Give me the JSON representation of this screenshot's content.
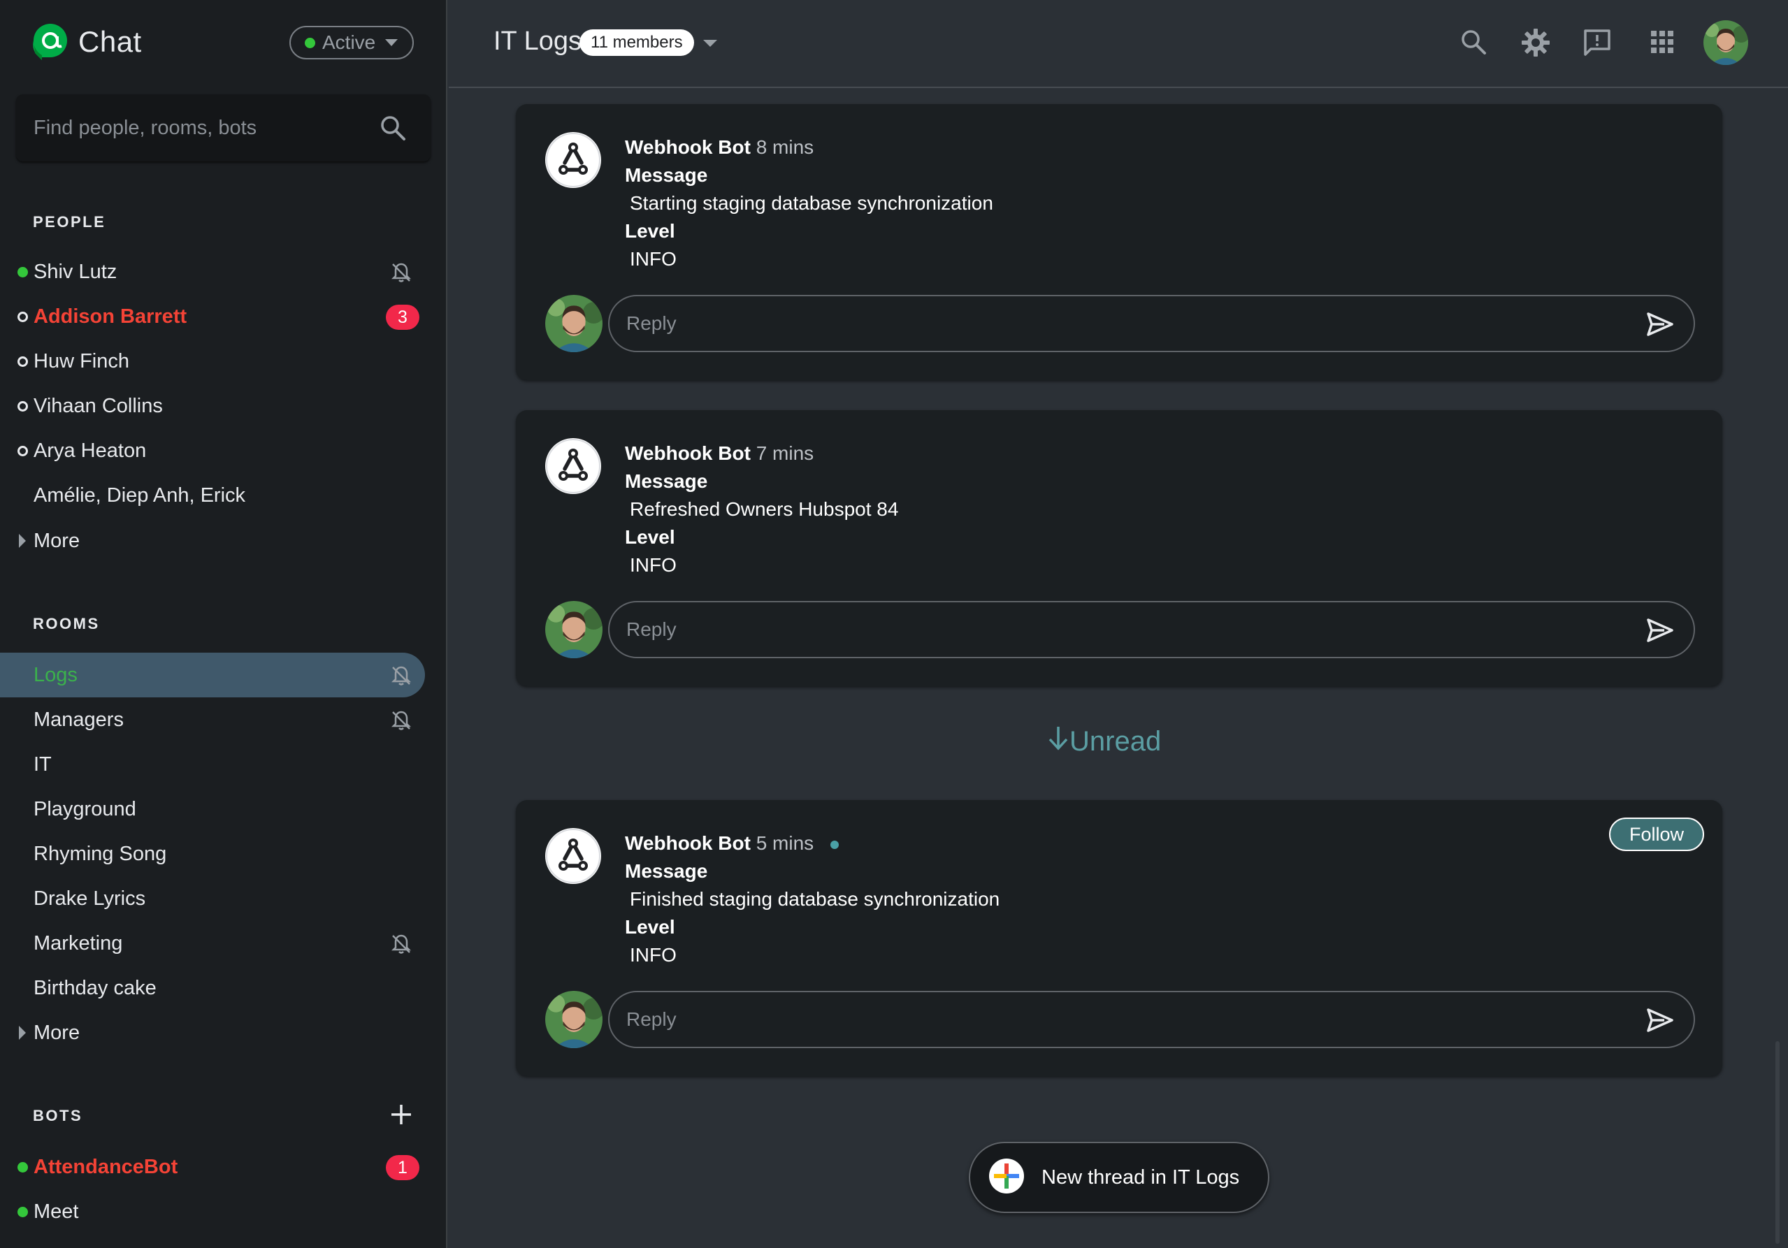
{
  "app": {
    "title": "Chat",
    "status": "Active",
    "accent": "#3bb14c",
    "alert_color": "#f44336"
  },
  "search": {
    "placeholder": "Find people, rooms, bots"
  },
  "people": {
    "heading": "PEOPLE",
    "items": [
      {
        "name": "Shiv Lutz",
        "presence": "online",
        "muted": true
      },
      {
        "name": "Addison Barrett",
        "presence": "offline",
        "badge": "3"
      },
      {
        "name": "Huw Finch",
        "presence": "offline"
      },
      {
        "name": "Vihaan Collins",
        "presence": "offline"
      },
      {
        "name": "Arya Heaton",
        "presence": "offline"
      },
      {
        "name": "Amélie, Diep Anh, Erick",
        "presence": "none"
      }
    ],
    "more": "More"
  },
  "rooms": {
    "heading": "ROOMS",
    "items": [
      {
        "name": "Logs",
        "selected": true,
        "muted": true
      },
      {
        "name": "Managers",
        "muted": true
      },
      {
        "name": "IT"
      },
      {
        "name": "Playground"
      },
      {
        "name": "Rhyming Song"
      },
      {
        "name": "Drake Lyrics"
      },
      {
        "name": "Marketing",
        "muted": true
      },
      {
        "name": "Birthday cake"
      }
    ],
    "more": "More"
  },
  "bots": {
    "heading": "BOTS",
    "items": [
      {
        "name": "AttendanceBot",
        "presence": "online",
        "badge": "1"
      },
      {
        "name": "Meet",
        "presence": "online"
      }
    ]
  },
  "header": {
    "room_title": "IT Logs",
    "members": "11 members",
    "icons": [
      "search-icon",
      "settings-icon",
      "feedback-icon",
      "apps-grid-icon",
      "account-avatar"
    ]
  },
  "messages": [
    {
      "author": "Webhook Bot",
      "time": "8 mins",
      "label1": "Message",
      "value1": "Starting staging database synchronization",
      "label2": "Level",
      "value2": "INFO",
      "reply_placeholder": "Reply"
    },
    {
      "author": "Webhook Bot",
      "time": "7 mins",
      "label1": "Message",
      "value1": "Refreshed Owners Hubspot 84",
      "label2": "Level",
      "value2": "INFO",
      "reply_placeholder": "Reply"
    },
    {
      "author": "Webhook Bot",
      "time": "5 mins",
      "label1": "Message",
      "value1": "Finished staging database synchronization",
      "label2": "Level",
      "value2": "INFO",
      "reply_placeholder": "Reply",
      "follow": "Follow"
    }
  ],
  "unread_label": "Unread",
  "new_thread": "New thread in IT Logs"
}
